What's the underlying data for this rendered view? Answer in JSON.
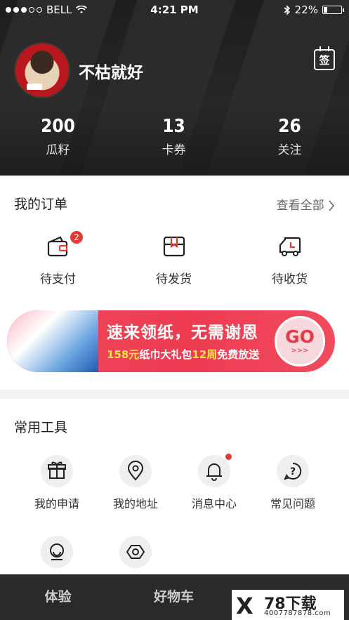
{
  "status_bar": {
    "carrier": "BELL",
    "time": "4:21 PM",
    "battery": "22%",
    "battery_level": 0.22
  },
  "profile": {
    "username": "不枯就好",
    "checkin_label": "签"
  },
  "stats": [
    {
      "value": "200",
      "label": "瓜籽"
    },
    {
      "value": "13",
      "label": "卡券"
    },
    {
      "value": "26",
      "label": "关注"
    }
  ],
  "orders": {
    "title": "我的订单",
    "view_all": "查看全部",
    "items": [
      {
        "label": "待支付",
        "icon": "wallet-icon",
        "badge": "2"
      },
      {
        "label": "待发货",
        "icon": "box-icon"
      },
      {
        "label": "待收货",
        "icon": "truck-icon"
      }
    ]
  },
  "banner": {
    "title": "速来领纸，无需谢恩",
    "sub_a": "158元",
    "sub_b": "纸巾大礼包",
    "sub_c": "12周",
    "sub_d": "免费放送",
    "go": "GO",
    "arrows": ">>>"
  },
  "tools": {
    "title": "常用工具",
    "items": [
      {
        "label": "我的申请",
        "icon": "gift-icon"
      },
      {
        "label": "我的地址",
        "icon": "location-pin-icon"
      },
      {
        "label": "消息中心",
        "icon": "bell-icon",
        "has_dot": true
      },
      {
        "label": "常见问题",
        "icon": "help-icon"
      },
      {
        "label": "",
        "icon": "customer-service-icon"
      },
      {
        "label": "",
        "icon": "settings-icon"
      }
    ]
  },
  "tabbar": {
    "tabs": [
      "体验",
      "好物车"
    ]
  },
  "watermark": {
    "mark": "X",
    "name": "78下载",
    "phone": "4007787878.com"
  },
  "colors": {
    "accent": "#e53935",
    "header_bg": "#222222",
    "banner_bg": "#ee3b51"
  }
}
